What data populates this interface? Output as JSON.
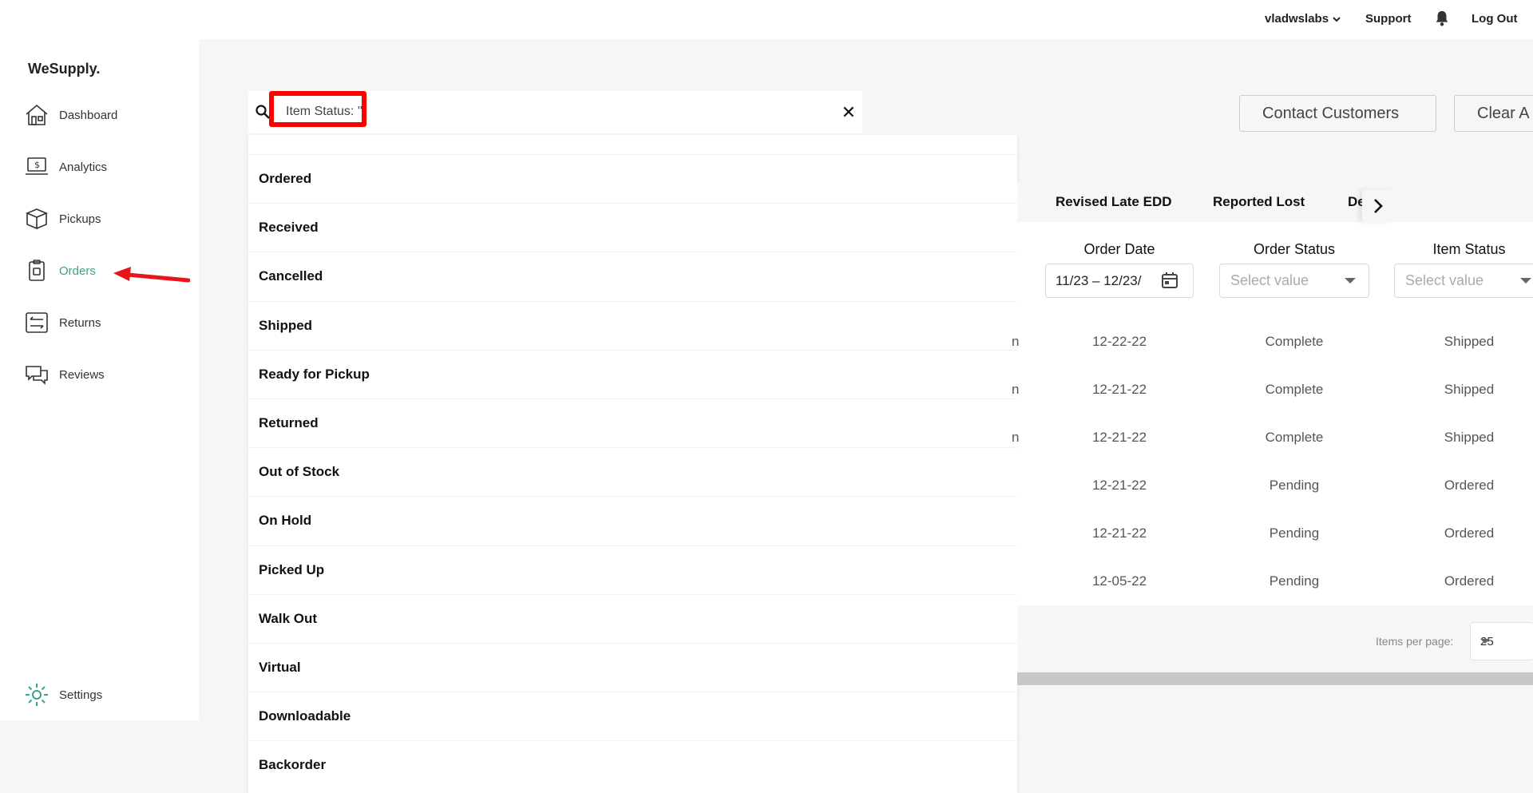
{
  "sidebar": {
    "logo": "WeSupply.",
    "items": [
      {
        "label": "Dashboard",
        "icon": "home-icon"
      },
      {
        "label": "Analytics",
        "icon": "analytics-icon"
      },
      {
        "label": "Pickups",
        "icon": "box-icon"
      },
      {
        "label": "Orders",
        "icon": "orders-icon"
      },
      {
        "label": "Returns",
        "icon": "returns-icon"
      },
      {
        "label": "Reviews",
        "icon": "reviews-icon"
      }
    ],
    "settings_label": "Settings",
    "accent_color": "#3aa38b"
  },
  "topbar": {
    "account": "vladwslabs",
    "support": "Support",
    "logout": "Log Out"
  },
  "search": {
    "value": "Item Status: ''"
  },
  "dropdown": {
    "options": [
      "Ordered",
      "Received",
      "Cancelled",
      "Shipped",
      "Ready for Pickup",
      "Returned",
      "Out of Stock",
      "On Hold",
      "Picked Up",
      "Walk Out",
      "Virtual",
      "Downloadable",
      "Backorder"
    ]
  },
  "actions": {
    "contact_customers": "Contact Customers",
    "clear": "Clear A"
  },
  "tabs": [
    "Revised Late EDD",
    "Reported Lost",
    "De"
  ],
  "table": {
    "headers": {
      "order_date": "Order Date",
      "order_status": "Order Status",
      "item_status": "Item Status"
    },
    "date_filter": "11/23 – 12/23/",
    "select_placeholder": "Select value",
    "rows": [
      {
        "date": "12-22-22",
        "order_status": "Complete",
        "item_status": "Shipped",
        "cut": "n"
      },
      {
        "date": "12-21-22",
        "order_status": "Complete",
        "item_status": "Shipped",
        "cut": "n"
      },
      {
        "date": "12-21-22",
        "order_status": "Complete",
        "item_status": "Shipped",
        "cut": "n"
      },
      {
        "date": "12-21-22",
        "order_status": "Pending",
        "item_status": "Ordered",
        "cut": ""
      },
      {
        "date": "12-21-22",
        "order_status": "Pending",
        "item_status": "Ordered",
        "cut": ""
      },
      {
        "date": "12-05-22",
        "order_status": "Pending",
        "item_status": "Ordered",
        "cut": ""
      }
    ]
  },
  "pagination": {
    "items_per_page_label": "Items per page:",
    "items_per_page": "25"
  }
}
